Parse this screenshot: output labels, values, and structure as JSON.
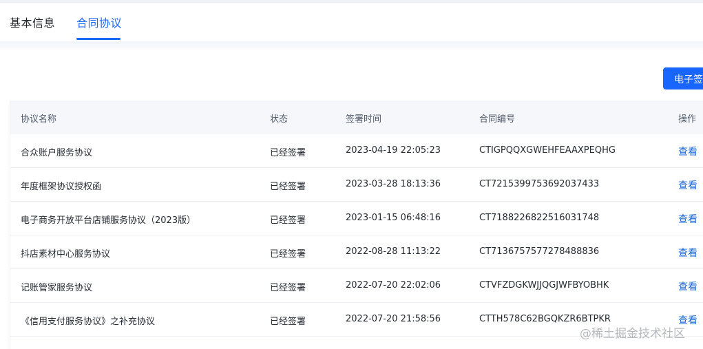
{
  "tabs": [
    {
      "label": "基本信息"
    },
    {
      "label": "合同协议"
    }
  ],
  "toolbar": {
    "esign_label": "电子签"
  },
  "table": {
    "headers": {
      "name": "协议名称",
      "status": "状态",
      "time": "签署时间",
      "contract_no": "合同编号",
      "action": "操作"
    },
    "rows": [
      {
        "name": "合众账户服务协议",
        "status": "已经签署",
        "time": "2023-04-19 22:05:23",
        "contract_no": "CTIGPQQXGWEHFEAAXPEQHG",
        "action": "查看"
      },
      {
        "name": "年度框架协议授权函",
        "status": "已经签署",
        "time": "2023-03-28 18:13:36",
        "contract_no": "CT7215399753692037433",
        "action": "查看"
      },
      {
        "name": "电子商务开放平台店铺服务协议（2023版）",
        "status": "已经签署",
        "time": "2023-01-15 06:48:16",
        "contract_no": "CT7188226822516031748",
        "action": "查看"
      },
      {
        "name": "抖店素材中心服务协议",
        "status": "已经签署",
        "time": "2022-08-28 11:13:22",
        "contract_no": "CT7136757577278488836",
        "action": "查看"
      },
      {
        "name": "记账管家服务协议",
        "status": "已经签署",
        "time": "2022-07-20 22:02:06",
        "contract_no": "CTVFZDGKWJJQGJWFBYOBHK",
        "action": "查看"
      },
      {
        "name": "《信用支付服务协议》之补充协议",
        "status": "已经签署",
        "time": "2022-07-20 21:58:56",
        "contract_no": "CTTH578C62BGQKZR6BTPKR",
        "action": "查看"
      }
    ]
  },
  "watermark": "@稀土掘金技术社区"
}
